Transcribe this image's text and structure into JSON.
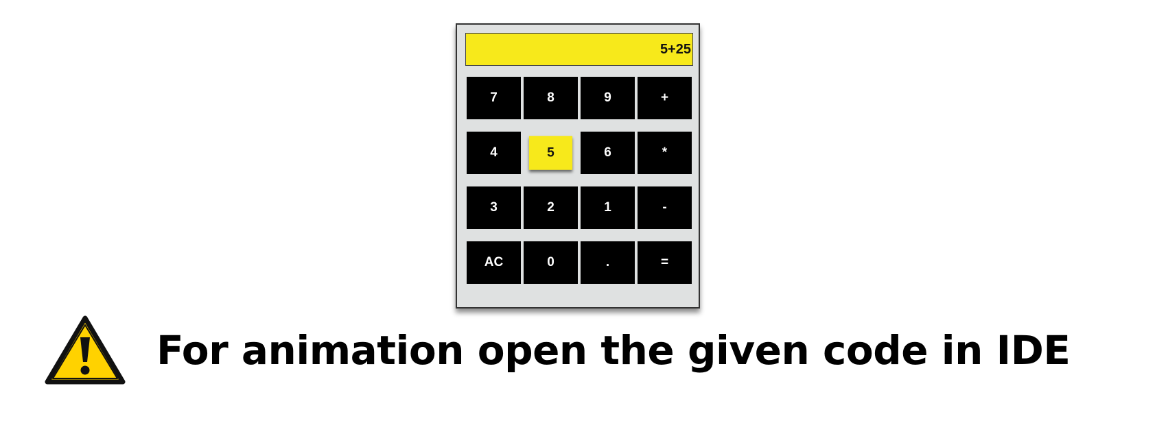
{
  "calculator": {
    "display": "5+25",
    "keys": [
      "7",
      "8",
      "9",
      "+",
      "4",
      "5",
      "6",
      "*",
      "3",
      "2",
      "1",
      "-",
      "AC",
      "0",
      ".",
      "="
    ],
    "active_key": "5",
    "display_color": "#f7e91b",
    "key_color": "#000000",
    "body_color": "#dfe1e1"
  },
  "notice": {
    "icon": "warning-triangle-icon",
    "icon_color": "#ffd200",
    "text": "For animation open the given code in IDE"
  }
}
